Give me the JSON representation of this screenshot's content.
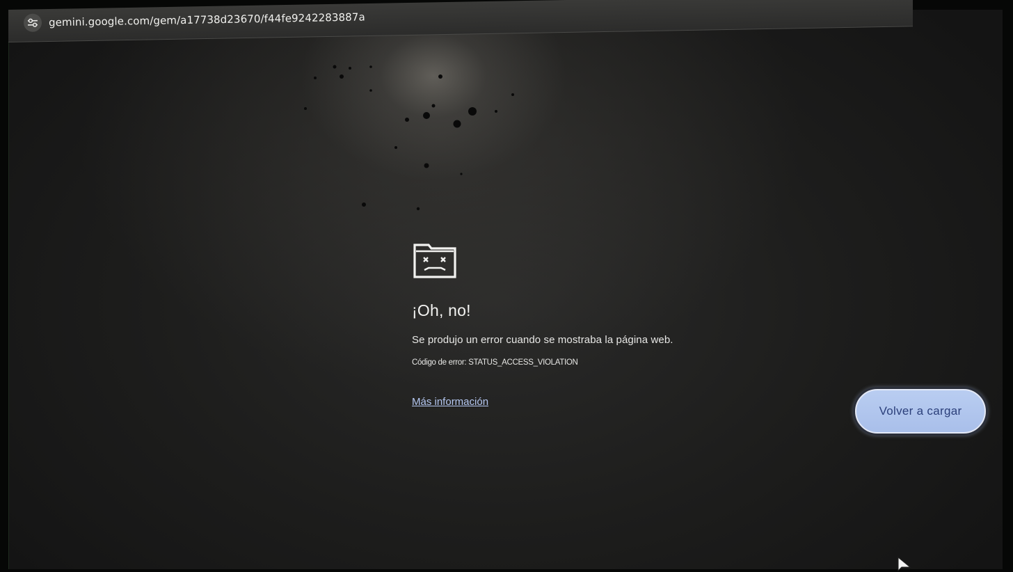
{
  "address_bar": {
    "url": "gemini.google.com/gem/a17738d23670/f44fe9242283887a",
    "site_info_icon": "tune-icon"
  },
  "error_page": {
    "icon": "sad-tab-icon",
    "title": "¡Oh, no!",
    "description": "Se produjo un error cuando se mostraba la página web.",
    "error_code": "Código de error: STATUS_ACCESS_VIOLATION",
    "more_info_link": "Más información",
    "reload_button": "Volver a cargar"
  },
  "colors": {
    "page_background": "#202020",
    "text": "#ececea",
    "link": "#b5c8f2",
    "button_background": "#b2c6ee",
    "button_text": "#2b3f7a"
  },
  "pointer_icon": "mouse-cursor-icon"
}
